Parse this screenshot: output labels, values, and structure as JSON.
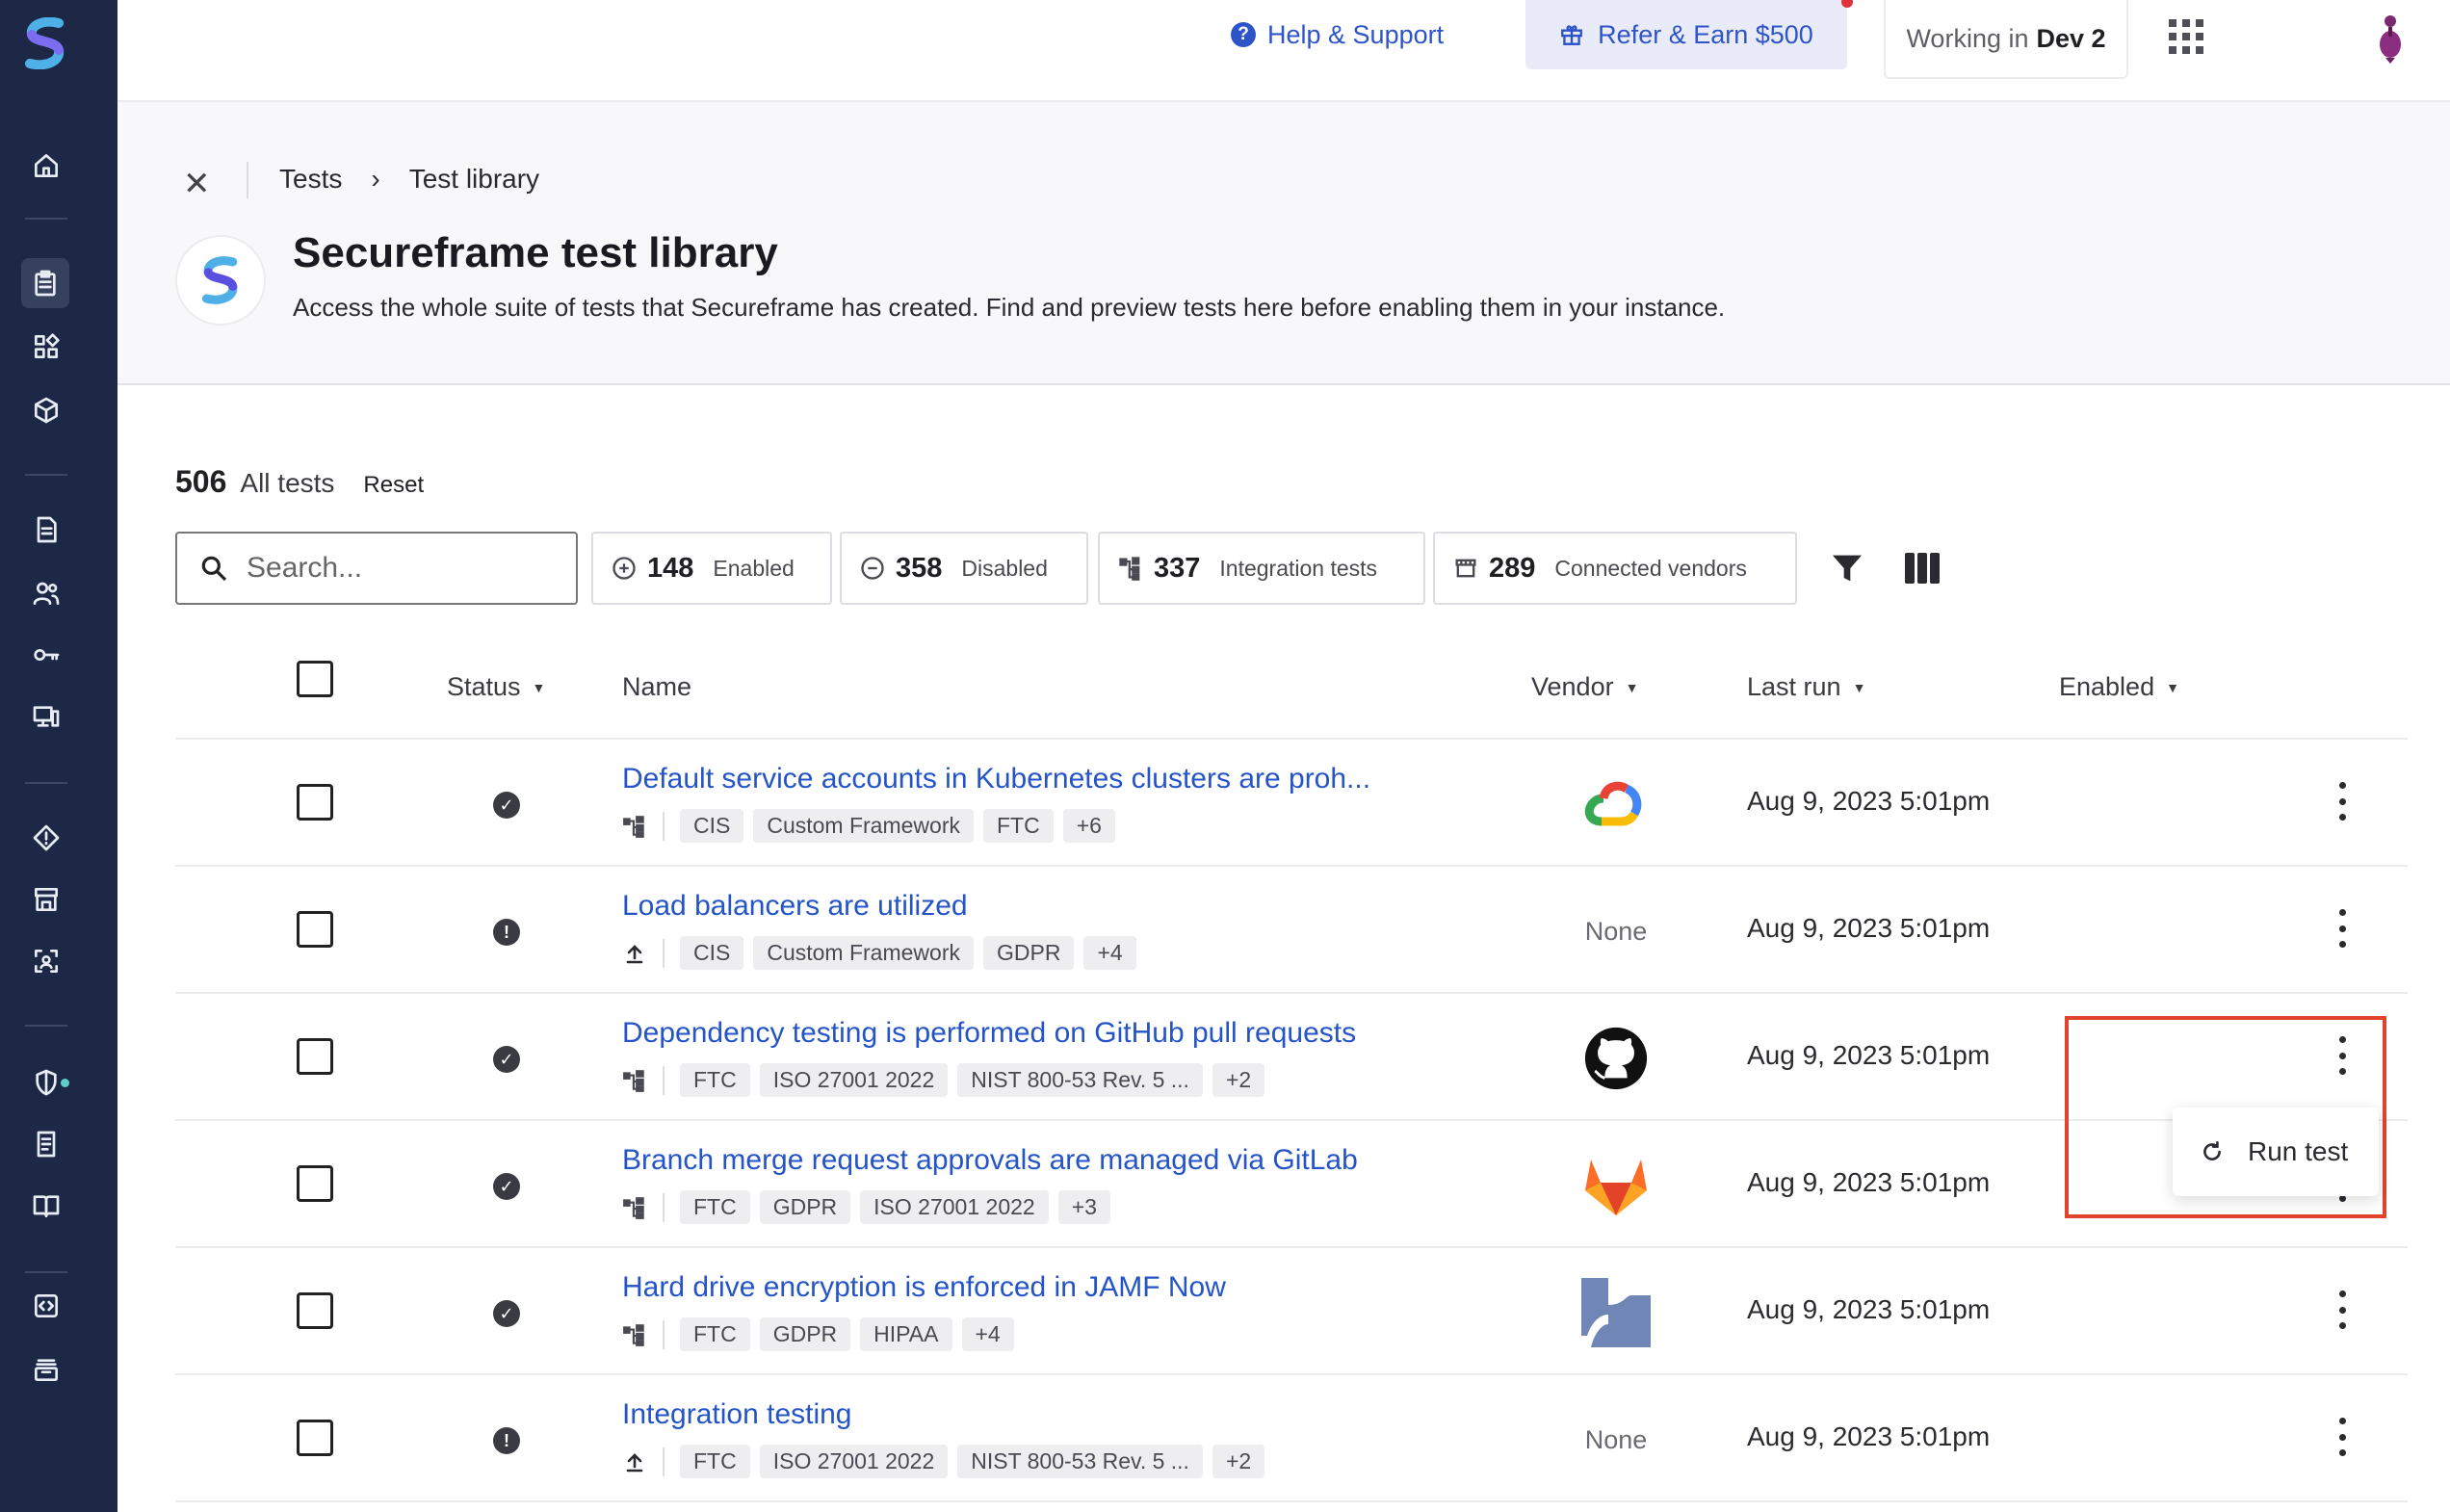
{
  "topbar": {
    "help_label": "Help & Support",
    "refer_label": "Refer & Earn $500",
    "working_prefix": "Working in",
    "workspace": "Dev 2"
  },
  "breadcrumb": {
    "items": [
      "Tests",
      "Test library"
    ]
  },
  "page": {
    "title": "Secureframe test library",
    "subtitle": "Access the whole suite of tests that Secureframe has created. Find and preview tests here before enabling them in your instance."
  },
  "summary": {
    "count": "506",
    "label": "All tests",
    "reset": "Reset"
  },
  "search": {
    "placeholder": "Search..."
  },
  "chips": [
    {
      "count": "148",
      "label": "Enabled",
      "icon": "plus-circle-icon"
    },
    {
      "count": "358",
      "label": "Disabled",
      "icon": "minus-circle-icon"
    },
    {
      "count": "337",
      "label": "Integration tests",
      "icon": "integration-icon"
    },
    {
      "count": "289",
      "label": "Connected vendors",
      "icon": "vendor-store-icon"
    }
  ],
  "table": {
    "headers": {
      "status": "Status",
      "name": "Name",
      "vendor": "Vendor",
      "last_run": "Last run",
      "enabled": "Enabled"
    },
    "rows": [
      {
        "name": "Default service accounts in Kubernetes clusters are proh...",
        "status": "pass",
        "type_icon": "integration-icon",
        "tags": [
          "CIS",
          "Custom Framework",
          "FTC",
          "+6"
        ],
        "vendor": "google-cloud-logo",
        "vendor_text": "",
        "last_run": "Aug 9, 2023 5:01pm"
      },
      {
        "name": "Load balancers are utilized",
        "status": "warning",
        "type_icon": "upload-icon",
        "tags": [
          "CIS",
          "Custom Framework",
          "GDPR",
          "+4"
        ],
        "vendor": "none",
        "vendor_text": "None",
        "last_run": "Aug 9, 2023 5:01pm"
      },
      {
        "name": "Dependency testing is performed on GitHub pull requests",
        "status": "pass",
        "type_icon": "integration-icon",
        "tags": [
          "FTC",
          "ISO 27001 2022",
          "NIST 800-53 Rev. 5 ...",
          "+2"
        ],
        "vendor": "github-logo",
        "vendor_text": "",
        "last_run": "Aug 9, 2023 5:01pm"
      },
      {
        "name": "Branch merge request approvals are managed via GitLab",
        "status": "pass",
        "type_icon": "integration-icon",
        "tags": [
          "FTC",
          "GDPR",
          "ISO 27001 2022",
          "+3"
        ],
        "vendor": "gitlab-logo",
        "vendor_text": "",
        "last_run": "Aug 9, 2023 5:01pm"
      },
      {
        "name": "Hard drive encryption is enforced in JAMF Now",
        "status": "pass",
        "type_icon": "integration-icon",
        "tags": [
          "FTC",
          "GDPR",
          "HIPAA",
          "+4"
        ],
        "vendor": "jamf-logo",
        "vendor_text": "",
        "last_run": "Aug 9, 2023 5:01pm"
      },
      {
        "name": "Integration testing",
        "status": "warning",
        "type_icon": "upload-icon",
        "tags": [
          "FTC",
          "ISO 27001 2022",
          "NIST 800-53 Rev. 5 ...",
          "+2"
        ],
        "vendor": "none",
        "vendor_text": "None",
        "last_run": "Aug 9, 2023 5:01pm"
      }
    ]
  },
  "row_menu": {
    "run_test": "Run test"
  },
  "colors": {
    "sidebar": "#1c2846",
    "link": "#2454c8",
    "accent": "#2f54c9",
    "highlight": "#e2432f"
  }
}
